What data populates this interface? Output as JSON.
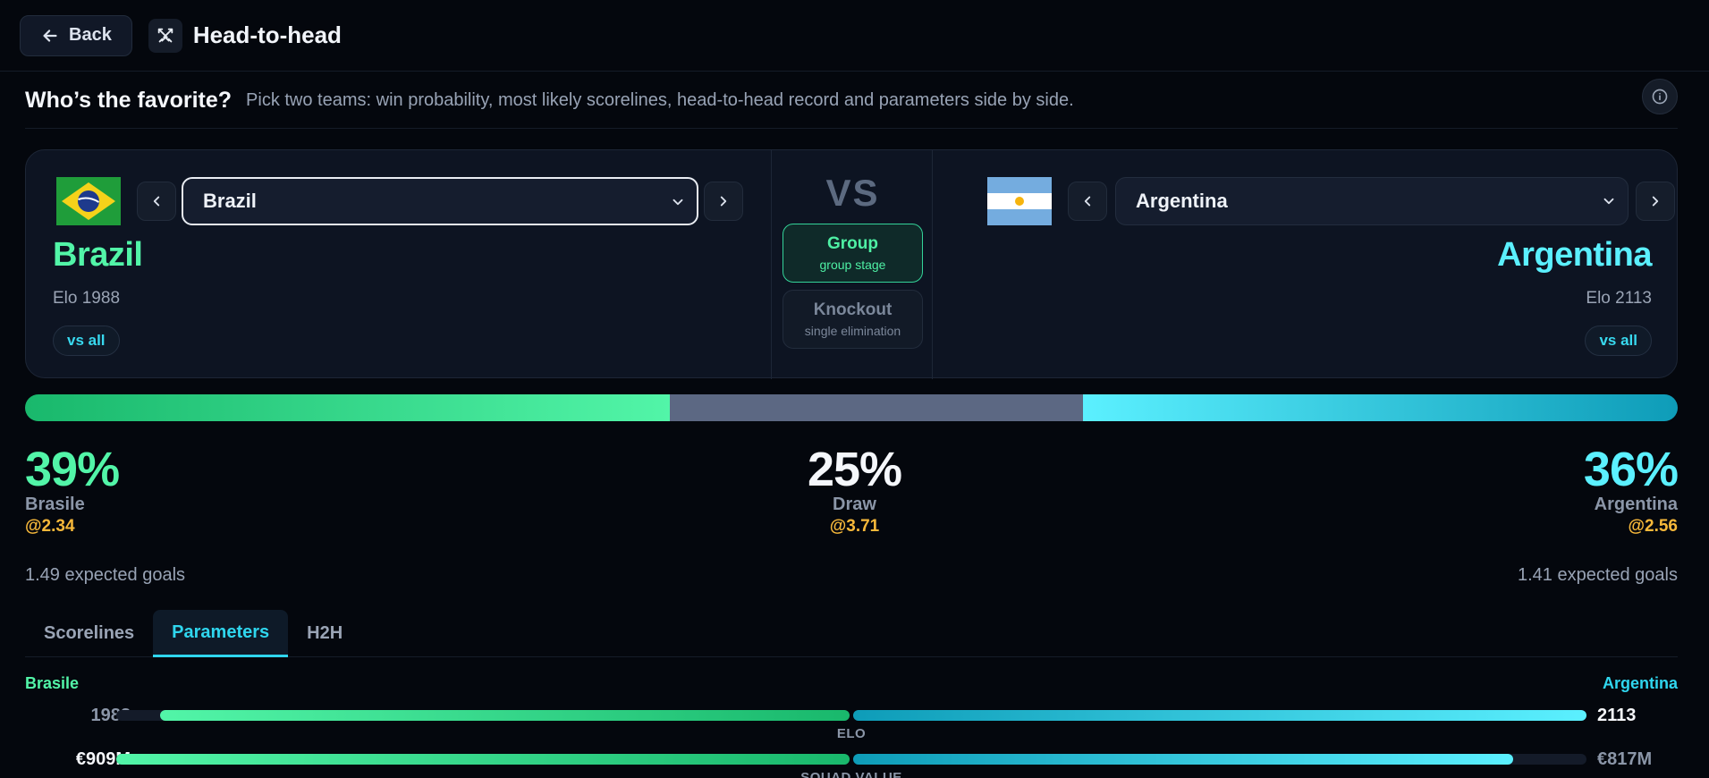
{
  "header": {
    "back_label": "Back",
    "title": "Head-to-head"
  },
  "intro": {
    "title": "Who’s the favorite?",
    "subtitle": "Pick two teams: win probability, most likely scorelines, head-to-head record and parameters side by side."
  },
  "home": {
    "select_value": "Brazil",
    "name": "Brazil",
    "elo": "Elo 1988",
    "vs_all": "vs all",
    "color": "#52f5a8"
  },
  "away": {
    "select_value": "Argentina",
    "name": "Argentina",
    "elo": "Elo 2113",
    "vs_all": "vs all",
    "color": "#5bf0ff"
  },
  "versus": {
    "label": "VS",
    "modes": [
      {
        "title": "Group",
        "subtitle": "group stage",
        "selected": true
      },
      {
        "title": "Knockout",
        "subtitle": "single elimination",
        "selected": false
      }
    ]
  },
  "probabilities": {
    "home": {
      "pct": "39%",
      "value": 39,
      "label": "Brasile",
      "odds": "@2.34"
    },
    "draw": {
      "pct": "25%",
      "value": 25,
      "label": "Draw",
      "odds": "@3.71"
    },
    "away": {
      "pct": "36%",
      "value": 36,
      "label": "Argentina",
      "odds": "@2.56"
    }
  },
  "expected_goals": {
    "home": "1.49 expected goals",
    "away": "1.41 expected goals"
  },
  "tabs": [
    {
      "label": "Scorelines",
      "active": false
    },
    {
      "label": "Parameters",
      "active": true
    },
    {
      "label": "H2H",
      "active": false
    }
  ],
  "parameters": {
    "home_label": "Brasile",
    "away_label": "Argentina",
    "rows": [
      {
        "name": "ELO",
        "home_value": "1988",
        "away_value": "2113",
        "home_fraction": 0.94,
        "away_fraction": 1.0
      },
      {
        "name": "SQUAD VALUE",
        "home_value": "€909M",
        "away_value": "€817M",
        "home_fraction": 1.0,
        "away_fraction": 0.9
      }
    ]
  },
  "icons": {
    "back": "arrow-left-icon",
    "page": "crossed-swords-icon",
    "info": "info-icon",
    "prev": "chevron-left-icon",
    "next": "chevron-right-icon",
    "dropdown": "chevron-down-icon"
  }
}
